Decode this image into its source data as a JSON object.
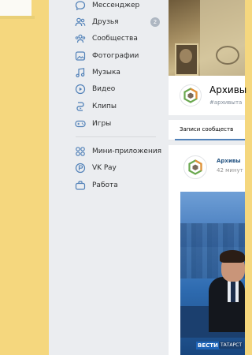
{
  "sidebar": {
    "items": [
      {
        "label": "Мессенджер"
      },
      {
        "label": "Друзья",
        "badge": "2"
      },
      {
        "label": "Сообщества"
      },
      {
        "label": "Фотографии"
      },
      {
        "label": "Музыка"
      },
      {
        "label": "Видео"
      },
      {
        "label": "Клипы"
      },
      {
        "label": "Игры"
      },
      {
        "label": "Мини-приложения"
      },
      {
        "label": "VK Pay"
      },
      {
        "label": "Работа"
      }
    ]
  },
  "group": {
    "title": "Архивы",
    "tag": "#архивыта"
  },
  "tabs": {
    "active_label": "Записи сообществ"
  },
  "post": {
    "author": "Архивы",
    "time": "42 минут"
  },
  "video": {
    "channel": "ВЕСТИ",
    "region": "ТАТАРСТ"
  },
  "colors": {
    "accent": "#5181b8",
    "link": "#2a5885",
    "sidebar_bg": "#ebedf0",
    "backdrop": "#f5d77e"
  }
}
